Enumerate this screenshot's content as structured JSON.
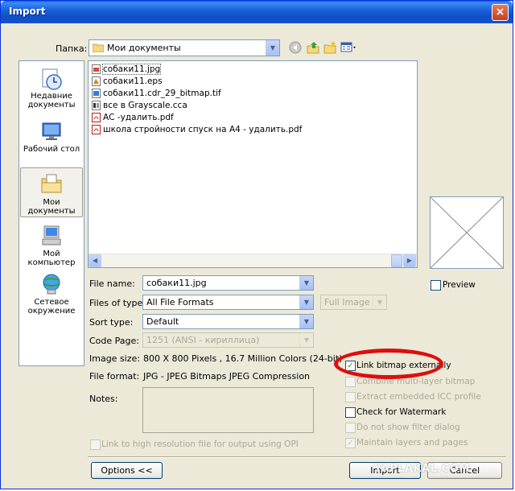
{
  "window": {
    "title": "Import",
    "close": "×"
  },
  "toolbar": {
    "folder_label": "Папка:",
    "folder_value": "Мои документы"
  },
  "places": [
    {
      "label_line1": "Недавние",
      "label_line2": "документы",
      "icon": "recent-documents-icon"
    },
    {
      "label_line1": "Рабочий стол",
      "label_line2": "",
      "icon": "desktop-icon"
    },
    {
      "label_line1": "Мои документы",
      "label_line2": "",
      "icon": "my-documents-icon",
      "selected": true
    },
    {
      "label_line1": "Мой компьютер",
      "label_line2": "",
      "icon": "my-computer-icon"
    },
    {
      "label_line1": "Сетевое",
      "label_line2": "окружение",
      "icon": "network-icon"
    }
  ],
  "files": [
    {
      "name": "собаки11.jpg",
      "icon": "jpg-file-icon",
      "selected": true
    },
    {
      "name": "собаки11.eps",
      "icon": "eps-file-icon"
    },
    {
      "name": "собаки11.cdr_29_bitmap.tif",
      "icon": "tif-file-icon"
    },
    {
      "name": "все в Grayscale.cca",
      "icon": "cca-file-icon"
    },
    {
      "name": "АС -удалить.pdf",
      "icon": "pdf-file-icon"
    },
    {
      "name": "школа стройности спуск на А4 - удалить.pdf",
      "icon": "pdf-file-icon"
    }
  ],
  "form": {
    "file_name_label": "File name:",
    "file_name_value": "собаки11.jpg",
    "files_of_type_label": "Files of type:",
    "files_of_type_value": "All File Formats",
    "full_image_value": "Full Image",
    "sort_type_label": "Sort type:",
    "sort_type_value": "Default",
    "code_page_label": "Code Page:",
    "code_page_value": "1251  (ANSI - кириллица)",
    "image_size_label": "Image size:",
    "image_size_value": "800 X 800 Pixels , 16.7 Million Colors (24-bit)",
    "file_format_label": "File format:",
    "file_format_value": "JPG - JPEG Bitmaps JPEG Compression",
    "notes_label": "Notes:"
  },
  "preview": {
    "label": "Preview",
    "checked": false
  },
  "options": [
    {
      "label": "Link bitmap externally",
      "checked": true,
      "enabled": true
    },
    {
      "label": "Combine multi-layer bitmap",
      "checked": false,
      "enabled": false
    },
    {
      "label": "Extract embedded ICC profile",
      "checked": false,
      "enabled": false
    },
    {
      "label": "Check for Watermark",
      "checked": false,
      "enabled": true
    },
    {
      "label": "Do not show filter dialog",
      "checked": false,
      "enabled": false
    },
    {
      "label": "Maintain layers and pages",
      "checked": true,
      "enabled": false
    }
  ],
  "link_high_res": {
    "label": "Link to high resolution file for output using OPI",
    "checked": false,
    "enabled": false
  },
  "buttons": {
    "options": "Options <<",
    "import": "Import",
    "cancel": "Cancel"
  },
  "watermark": "YAPLAKAL.COM"
}
